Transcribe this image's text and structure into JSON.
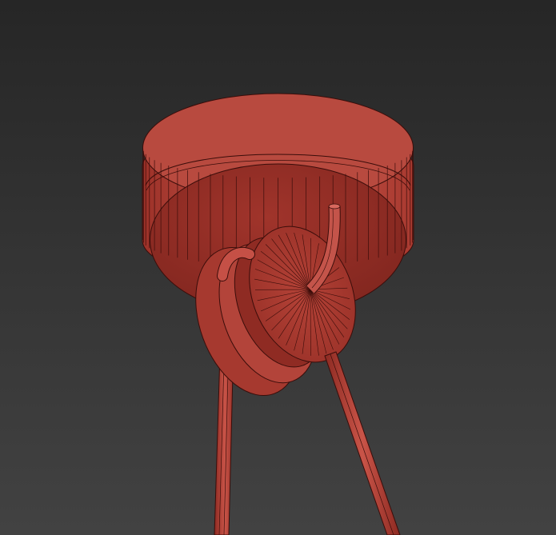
{
  "scene": {
    "subject": "ceiling-rose-with-hook-and-pulley-wireframe",
    "colors": {
      "background_top": "#262626",
      "background_bottom": "#424242",
      "surface_dark": "#8f2a22",
      "surface": "#b8473c",
      "surface_light": "#cf6157",
      "wire": "#3a0d0a"
    }
  }
}
